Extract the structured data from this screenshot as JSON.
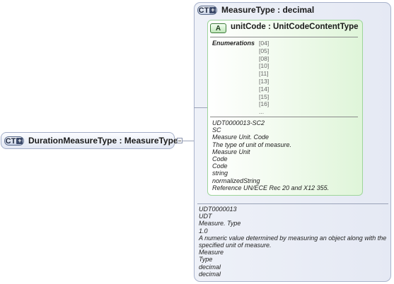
{
  "root": {
    "badge": "CT",
    "label": "DurationMeasureType : MeasureType"
  },
  "type": {
    "badge": "CT",
    "title": "MeasureType : decimal",
    "documentation": [
      "UDT0000013",
      "UDT",
      "Measure. Type",
      "1.0",
      "A numeric value determined by measuring an object along with the specified unit of measure.",
      "Measure",
      "Type",
      "decimal",
      "decimal"
    ]
  },
  "attribute": {
    "badge": "A",
    "title": "unitCode : UnitCodeContentType",
    "enumerations_label": "Enumerations",
    "enumerations": [
      "[04]",
      "[05]",
      "[08]",
      "[10]",
      "[11]",
      "[13]",
      "[14]",
      "[15]",
      "[16]",
      "..."
    ],
    "documentation": [
      "UDT0000013-SC2",
      "SC",
      "Measure Unit. Code",
      "The type of unit of measure.",
      "Measure Unit",
      "Code",
      "Code",
      "string",
      "normalizedString",
      "Reference UN/ECE Rec 20 and X12 355."
    ]
  }
}
